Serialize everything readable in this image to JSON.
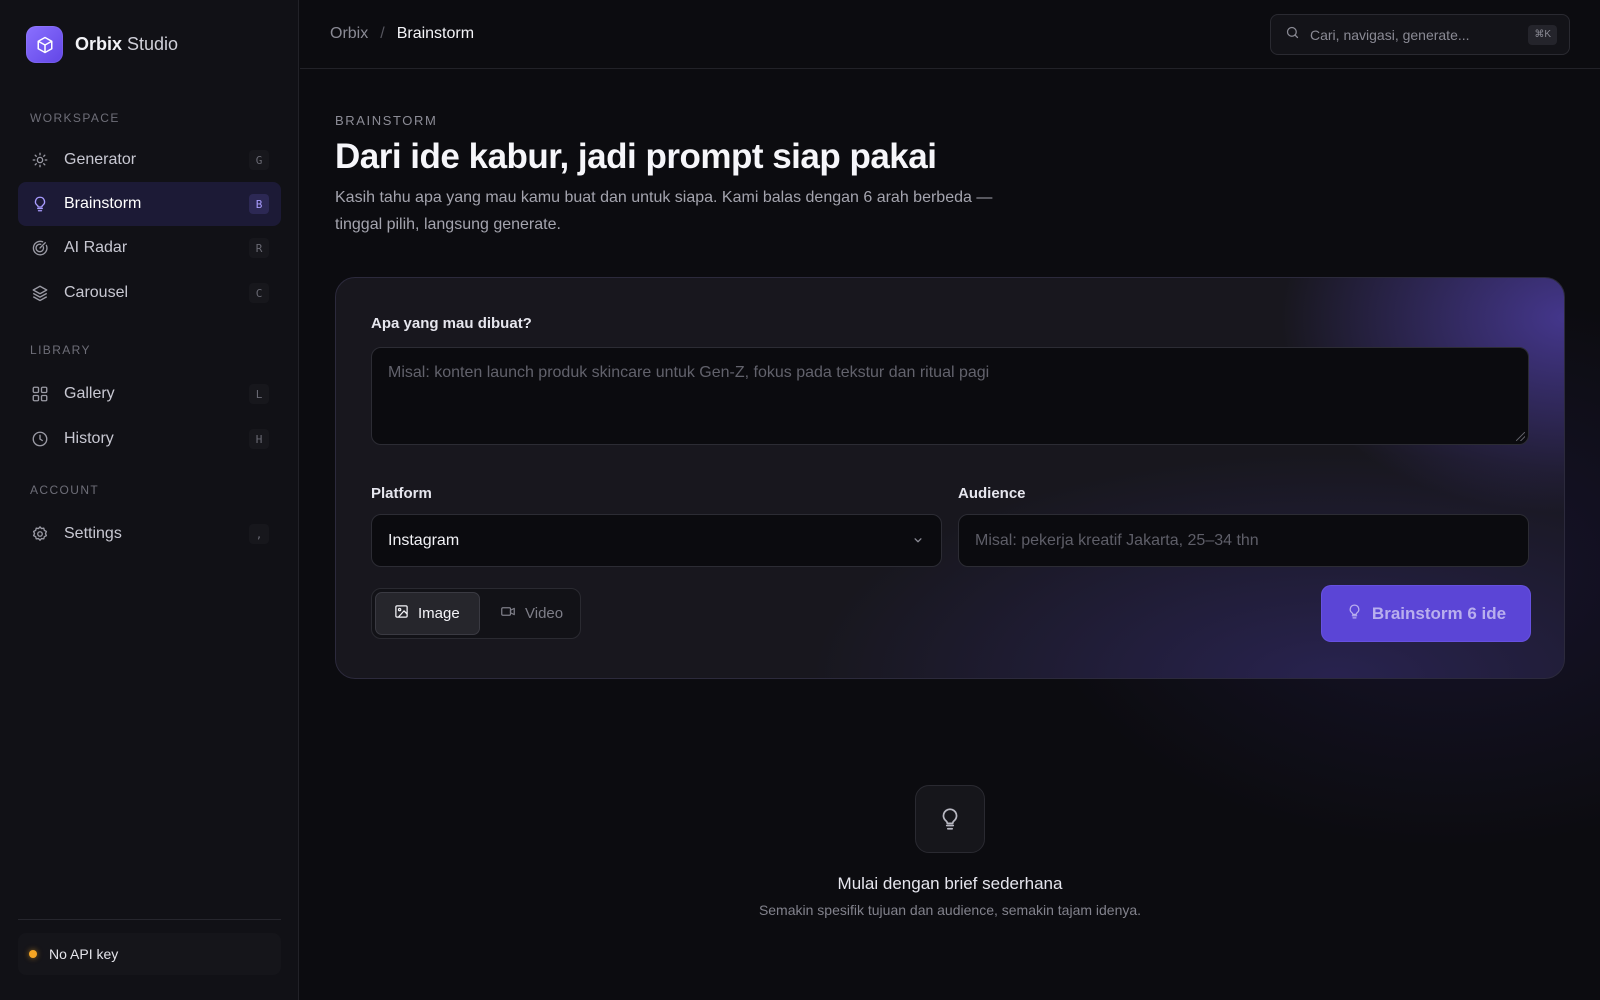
{
  "app": {
    "brand_bold": "Orbix",
    "brand_light": "Studio"
  },
  "sidebar": {
    "sections": [
      {
        "label": "WORKSPACE",
        "items": [
          {
            "label": "Generator",
            "shortcut": "G",
            "icon": "sun-icon",
            "active": false
          },
          {
            "label": "Brainstorm",
            "shortcut": "B",
            "icon": "lightbulb-icon",
            "active": true
          },
          {
            "label": "AI Radar",
            "shortcut": "R",
            "icon": "radar-icon",
            "active": false
          },
          {
            "label": "Carousel",
            "shortcut": "C",
            "icon": "layers-icon",
            "active": false
          }
        ]
      },
      {
        "label": "LIBRARY",
        "items": [
          {
            "label": "Gallery",
            "shortcut": "L",
            "icon": "grid-icon",
            "active": false
          },
          {
            "label": "History",
            "shortcut": "H",
            "icon": "clock-icon",
            "active": false
          }
        ]
      },
      {
        "label": "ACCOUNT",
        "items": [
          {
            "label": "Settings",
            "shortcut": ",",
            "icon": "gear-icon",
            "active": false
          }
        ]
      }
    ],
    "api_status": {
      "label": "No API key",
      "color": "#f5a524"
    }
  },
  "topbar": {
    "breadcrumb": {
      "root": "Orbix",
      "separator": "/",
      "current": "Brainstorm"
    },
    "search": {
      "placeholder": "Cari, navigasi, generate...",
      "shortcut": "⌘K"
    }
  },
  "main": {
    "eyebrow": "BRAINSTORM",
    "title": "Dari ide kabur, jadi prompt siap pakai",
    "description": "Kasih tahu apa yang mau kamu buat dan untuk siapa. Kami balas dengan 6 arah berbeda — tinggal pilih, langsung generate.",
    "form": {
      "brief_label": "Apa yang mau dibuat?",
      "brief_placeholder": "Misal: konten launch produk skincare untuk Gen-Z, fokus pada tekstur dan ritual pagi",
      "platform_label": "Platform",
      "platform_value": "Instagram",
      "audience_label": "Audience",
      "audience_placeholder": "Misal: pekerja kreatif Jakarta, 25–34 thn",
      "media_options": [
        {
          "label": "Image",
          "icon": "image-icon",
          "selected": true
        },
        {
          "label": "Video",
          "icon": "video-icon",
          "selected": false
        }
      ],
      "submit_label": "Brainstorm 6 ide"
    },
    "empty_state": {
      "title": "Mulai dengan brief sederhana",
      "subtitle": "Semakin spesifik tujuan dan audience, semakin tajam idenya."
    }
  },
  "colors": {
    "accent": "#5b45d6",
    "accent_active_bg": "#1c1a36",
    "background": "#0c0c10",
    "sidebar_bg": "#111116"
  }
}
